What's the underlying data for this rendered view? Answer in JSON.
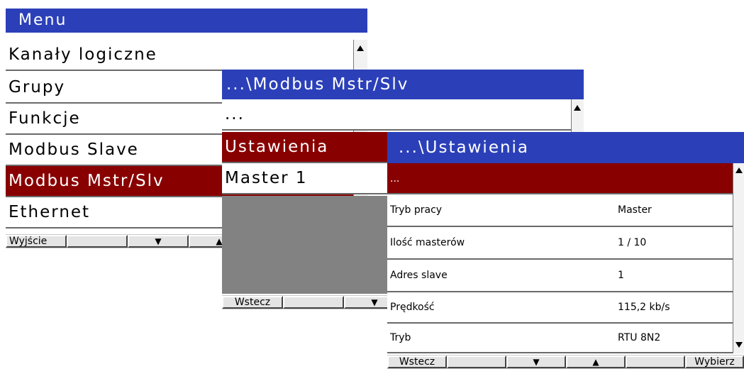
{
  "menu": {
    "title": "Menu",
    "items": [
      "Kanały logiczne",
      "Grupy",
      "Funkcje",
      "Modbus Slave",
      "Modbus Mstr/Slv",
      "Ethernet"
    ],
    "selected_index": 4,
    "buttons": {
      "exit": "Wyjście",
      "down": "▼",
      "up": "▲"
    }
  },
  "modbus": {
    "title": "...\\Modbus Mstr/Slv",
    "items": [
      "...",
      "Ustawienia",
      "Master 1"
    ],
    "selected_index": 1,
    "buttons": {
      "back": "Wstecz",
      "down": "▼"
    }
  },
  "settings": {
    "title": "...\\Ustawienia",
    "top_item": "...",
    "rows": [
      {
        "label": "Tryb pracy",
        "value": "Master"
      },
      {
        "label": "Ilość masterów",
        "value": "1 / 10"
      },
      {
        "label": "Adres slave",
        "value": "1"
      },
      {
        "label": "Prędkość",
        "value": "115,2 kb/s"
      },
      {
        "label": "Tryb",
        "value": "RTU 8N2"
      }
    ],
    "buttons": {
      "back": "Wstecz",
      "down": "▼",
      "up": "▲",
      "select": "Wybierz"
    }
  },
  "colors": {
    "title_bar": "#2b40b8",
    "selected": "#880000",
    "panel_gray": "#828282"
  }
}
